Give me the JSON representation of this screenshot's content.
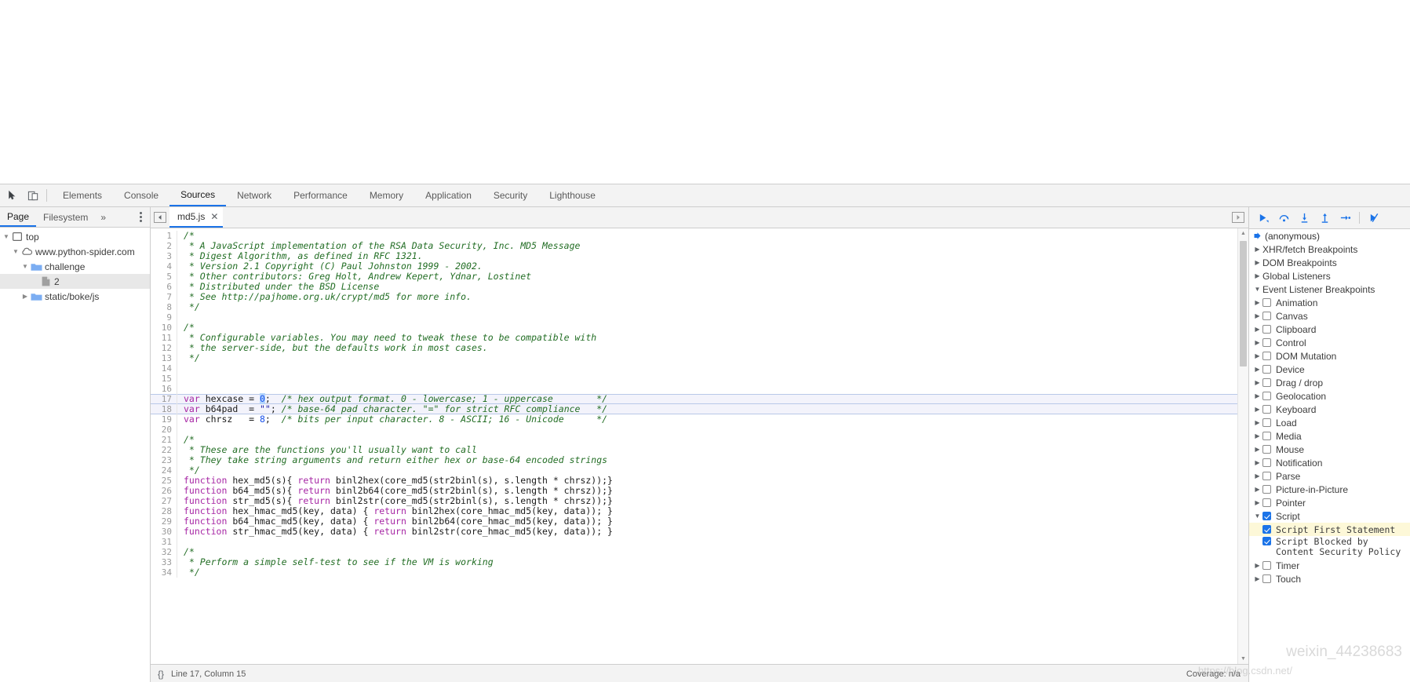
{
  "main_toolbar": {
    "inspect_icon": "inspect-cursor-icon",
    "device_toggle_icon": "device-toolbar-icon",
    "tabs": [
      {
        "label": "Elements",
        "selected": false
      },
      {
        "label": "Console",
        "selected": false
      },
      {
        "label": "Sources",
        "selected": true
      },
      {
        "label": "Network",
        "selected": false
      },
      {
        "label": "Performance",
        "selected": false
      },
      {
        "label": "Memory",
        "selected": false
      },
      {
        "label": "Application",
        "selected": false
      },
      {
        "label": "Security",
        "selected": false
      },
      {
        "label": "Lighthouse",
        "selected": false
      }
    ]
  },
  "navigator": {
    "tabs": [
      {
        "label": "Page",
        "selected": true
      },
      {
        "label": "Filesystem",
        "selected": false
      }
    ],
    "more_label": "»",
    "tree": [
      {
        "label": "top",
        "depth": 0,
        "twisty": "down",
        "icon": "frame-icon",
        "selected": false
      },
      {
        "label": "www.python-spider.com",
        "depth": 1,
        "twisty": "down",
        "icon": "cloud-icon",
        "selected": false
      },
      {
        "label": "challenge",
        "depth": 2,
        "twisty": "down",
        "icon": "folder-icon",
        "selected": false
      },
      {
        "label": "2",
        "depth": 3,
        "twisty": "none",
        "icon": "document-icon",
        "selected": true
      },
      {
        "label": "static/boke/js",
        "depth": 2,
        "twisty": "right",
        "icon": "folder-icon",
        "selected": false
      }
    ]
  },
  "editor": {
    "tab_name": "md5.js",
    "close_label": "✕",
    "lines": [
      {
        "n": 1,
        "state": "normal",
        "tokens": [
          {
            "t": "cmt",
            "s": "/*"
          }
        ]
      },
      {
        "n": 2,
        "state": "normal",
        "tokens": [
          {
            "t": "cmt",
            "s": " * A JavaScript implementation of the RSA Data Security, Inc. MD5 Message"
          }
        ]
      },
      {
        "n": 3,
        "state": "normal",
        "tokens": [
          {
            "t": "cmt",
            "s": " * Digest Algorithm, as defined in RFC 1321."
          }
        ]
      },
      {
        "n": 4,
        "state": "normal",
        "tokens": [
          {
            "t": "cmt",
            "s": " * Version 2.1 Copyright (C) Paul Johnston 1999 - 2002."
          }
        ]
      },
      {
        "n": 5,
        "state": "normal",
        "tokens": [
          {
            "t": "cmt",
            "s": " * Other contributors: Greg Holt, Andrew Kepert, Ydnar, Lostinet"
          }
        ]
      },
      {
        "n": 6,
        "state": "normal",
        "tokens": [
          {
            "t": "cmt",
            "s": " * Distributed under the BSD License"
          }
        ]
      },
      {
        "n": 7,
        "state": "normal",
        "tokens": [
          {
            "t": "cmt",
            "s": " * See http://pajhome.org.uk/crypt/md5 for more info."
          }
        ]
      },
      {
        "n": 8,
        "state": "normal",
        "tokens": [
          {
            "t": "cmt",
            "s": " */"
          }
        ]
      },
      {
        "n": 9,
        "state": "normal",
        "tokens": []
      },
      {
        "n": 10,
        "state": "normal",
        "tokens": [
          {
            "t": "cmt",
            "s": "/*"
          }
        ]
      },
      {
        "n": 11,
        "state": "normal",
        "tokens": [
          {
            "t": "cmt",
            "s": " * Configurable variables. You may need to tweak these to be compatible with"
          }
        ]
      },
      {
        "n": 12,
        "state": "normal",
        "tokens": [
          {
            "t": "cmt",
            "s": " * the server-side, but the defaults work in most cases."
          }
        ]
      },
      {
        "n": 13,
        "state": "normal",
        "tokens": [
          {
            "t": "cmt",
            "s": " */"
          }
        ]
      },
      {
        "n": 14,
        "state": "normal",
        "tokens": []
      },
      {
        "n": 15,
        "state": "normal",
        "tokens": []
      },
      {
        "n": 16,
        "state": "normal",
        "tokens": []
      },
      {
        "n": 17,
        "state": "hl",
        "tokens": [
          {
            "t": "kw",
            "s": "var"
          },
          {
            "t": "plain",
            "s": " hexcase = "
          },
          {
            "t": "sel",
            "s": "0"
          },
          {
            "t": "plain",
            "s": ";  "
          },
          {
            "t": "cmt",
            "s": "/* hex output format. 0 - lowercase; 1 - uppercase        */"
          }
        ]
      },
      {
        "n": 18,
        "state": "hl-mid",
        "tokens": [
          {
            "t": "kw",
            "s": "var"
          },
          {
            "t": "plain",
            "s": " b64pad  = "
          },
          {
            "t": "str",
            "s": "\"\""
          },
          {
            "t": "plain",
            "s": "; "
          },
          {
            "t": "cmt",
            "s": "/* base-64 pad character. \"=\" for strict RFC compliance   */"
          }
        ]
      },
      {
        "n": 19,
        "state": "normal",
        "tokens": [
          {
            "t": "kw",
            "s": "var"
          },
          {
            "t": "plain",
            "s": " chrsz   = "
          },
          {
            "t": "num",
            "s": "8"
          },
          {
            "t": "plain",
            "s": ";  "
          },
          {
            "t": "cmt",
            "s": "/* bits per input character. 8 - ASCII; 16 - Unicode      */"
          }
        ]
      },
      {
        "n": 20,
        "state": "normal",
        "tokens": []
      },
      {
        "n": 21,
        "state": "normal",
        "tokens": [
          {
            "t": "cmt",
            "s": "/*"
          }
        ]
      },
      {
        "n": 22,
        "state": "normal",
        "tokens": [
          {
            "t": "cmt",
            "s": " * These are the functions you'll usually want to call"
          }
        ]
      },
      {
        "n": 23,
        "state": "normal",
        "tokens": [
          {
            "t": "cmt",
            "s": " * They take string arguments and return either hex or base-64 encoded strings"
          }
        ]
      },
      {
        "n": 24,
        "state": "normal",
        "tokens": [
          {
            "t": "cmt",
            "s": " */"
          }
        ]
      },
      {
        "n": 25,
        "state": "normal",
        "tokens": [
          {
            "t": "kw",
            "s": "function"
          },
          {
            "t": "plain",
            "s": " hex_md5(s){ "
          },
          {
            "t": "kw",
            "s": "return"
          },
          {
            "t": "plain",
            "s": " binl2hex(core_md5(str2binl(s), s.length * chrsz));}"
          }
        ]
      },
      {
        "n": 26,
        "state": "normal",
        "tokens": [
          {
            "t": "kw",
            "s": "function"
          },
          {
            "t": "plain",
            "s": " b64_md5(s){ "
          },
          {
            "t": "kw",
            "s": "return"
          },
          {
            "t": "plain",
            "s": " binl2b64(core_md5(str2binl(s), s.length * chrsz));}"
          }
        ]
      },
      {
        "n": 27,
        "state": "normal",
        "tokens": [
          {
            "t": "kw",
            "s": "function"
          },
          {
            "t": "plain",
            "s": " str_md5(s){ "
          },
          {
            "t": "kw",
            "s": "return"
          },
          {
            "t": "plain",
            "s": " binl2str(core_md5(str2binl(s), s.length * chrsz));}"
          }
        ]
      },
      {
        "n": 28,
        "state": "normal",
        "tokens": [
          {
            "t": "kw",
            "s": "function"
          },
          {
            "t": "plain",
            "s": " hex_hmac_md5(key, data) { "
          },
          {
            "t": "kw",
            "s": "return"
          },
          {
            "t": "plain",
            "s": " binl2hex(core_hmac_md5(key, data)); }"
          }
        ]
      },
      {
        "n": 29,
        "state": "normal",
        "tokens": [
          {
            "t": "kw",
            "s": "function"
          },
          {
            "t": "plain",
            "s": " b64_hmac_md5(key, data) { "
          },
          {
            "t": "kw",
            "s": "return"
          },
          {
            "t": "plain",
            "s": " binl2b64(core_hmac_md5(key, data)); }"
          }
        ]
      },
      {
        "n": 30,
        "state": "normal",
        "tokens": [
          {
            "t": "kw",
            "s": "function"
          },
          {
            "t": "plain",
            "s": " str_hmac_md5(key, data) { "
          },
          {
            "t": "kw",
            "s": "return"
          },
          {
            "t": "plain",
            "s": " binl2str(core_hmac_md5(key, data)); }"
          }
        ]
      },
      {
        "n": 31,
        "state": "normal",
        "tokens": []
      },
      {
        "n": 32,
        "state": "normal",
        "tokens": [
          {
            "t": "cmt",
            "s": "/*"
          }
        ]
      },
      {
        "n": 33,
        "state": "normal",
        "tokens": [
          {
            "t": "cmt",
            "s": " * Perform a simple self-test to see if the VM is working"
          }
        ]
      },
      {
        "n": 34,
        "state": "normal",
        "tokens": [
          {
            "t": "cmt",
            "s": " */"
          }
        ]
      }
    ]
  },
  "status_bar": {
    "format_icon": "pretty-print-braces-icon",
    "position": "Line 17, Column 15",
    "coverage": "Coverage: n/a"
  },
  "debugger": {
    "toolbar": [
      {
        "name": "resume-script-execution-button",
        "icon": "resume-icon"
      },
      {
        "name": "step-over-button",
        "icon": "step-over-icon"
      },
      {
        "name": "step-into-button",
        "icon": "step-into-icon"
      },
      {
        "name": "step-out-button",
        "icon": "step-out-icon"
      },
      {
        "name": "step-button",
        "icon": "step-icon"
      },
      {
        "name": "deactivate-breakpoints-button",
        "icon": "deactivate-breakpoints-icon"
      }
    ],
    "sections": [
      {
        "label": "(anonymous)",
        "type": "callframe",
        "twisty": "none",
        "arrow": true
      },
      {
        "label": "XHR/fetch Breakpoints",
        "type": "section",
        "twisty": "right"
      },
      {
        "label": "DOM Breakpoints",
        "type": "section",
        "twisty": "right"
      },
      {
        "label": "Global Listeners",
        "type": "section",
        "twisty": "right"
      },
      {
        "label": "Event Listener Breakpoints",
        "type": "section",
        "twisty": "down"
      }
    ],
    "event_listener_groups": [
      {
        "label": "Animation",
        "checked": false,
        "twisty": "right"
      },
      {
        "label": "Canvas",
        "checked": false,
        "twisty": "right"
      },
      {
        "label": "Clipboard",
        "checked": false,
        "twisty": "right"
      },
      {
        "label": "Control",
        "checked": false,
        "twisty": "right"
      },
      {
        "label": "DOM Mutation",
        "checked": false,
        "twisty": "right"
      },
      {
        "label": "Device",
        "checked": false,
        "twisty": "right"
      },
      {
        "label": "Drag / drop",
        "checked": false,
        "twisty": "right"
      },
      {
        "label": "Geolocation",
        "checked": false,
        "twisty": "right"
      },
      {
        "label": "Keyboard",
        "checked": false,
        "twisty": "right"
      },
      {
        "label": "Load",
        "checked": false,
        "twisty": "right"
      },
      {
        "label": "Media",
        "checked": false,
        "twisty": "right"
      },
      {
        "label": "Mouse",
        "checked": false,
        "twisty": "right"
      },
      {
        "label": "Notification",
        "checked": false,
        "twisty": "right"
      },
      {
        "label": "Parse",
        "checked": false,
        "twisty": "right"
      },
      {
        "label": "Picture-in-Picture",
        "checked": false,
        "twisty": "right"
      },
      {
        "label": "Pointer",
        "checked": false,
        "twisty": "right"
      },
      {
        "label": "Script",
        "checked": true,
        "twisty": "down"
      }
    ],
    "script_children": [
      {
        "label": "Script First Statement",
        "checked": true,
        "highlight": true
      },
      {
        "label": "Script Blocked by Content Security Policy",
        "checked": true,
        "highlight": false
      }
    ],
    "event_listener_groups_after": [
      {
        "label": "Timer",
        "checked": false,
        "twisty": "right"
      },
      {
        "label": "Touch",
        "checked": false,
        "twisty": "right"
      }
    ]
  },
  "watermark": {
    "text": "weixin_44238683",
    "url": "https://blog.csdn.net/"
  },
  "colors": {
    "accent": "#1a73e8",
    "toolbar_bg": "#f3f3f3",
    "comment_green": "#236e25",
    "keyword_purple": "#a626a4",
    "number_blue": "#1750eb",
    "highlight_yellow": "#fdf8d8",
    "selection_blue": "#b3d4fc"
  }
}
